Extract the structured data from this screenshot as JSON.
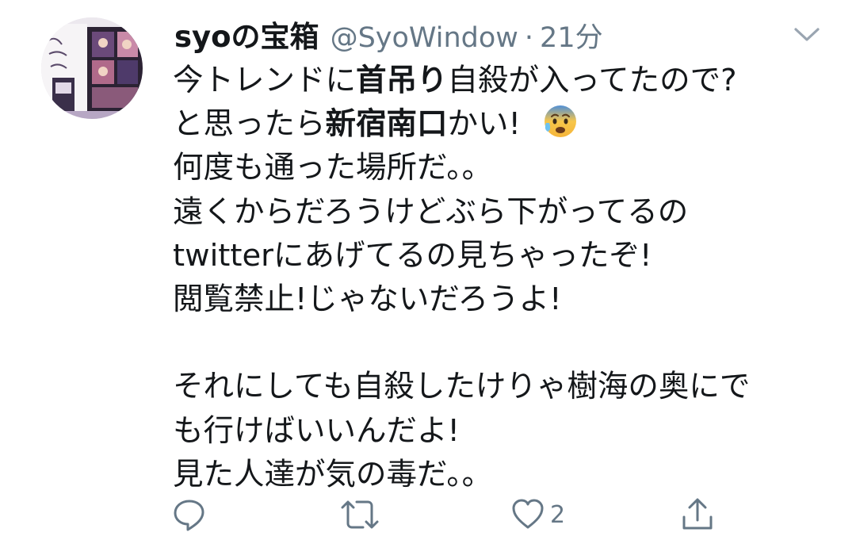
{
  "tweet": {
    "author": {
      "display_name": "syoの宝箱",
      "handle": "@SyoWindow",
      "separator": "·",
      "time": "21分"
    },
    "body": {
      "l1_a": "今トレンドに",
      "l1_b": "首吊り",
      "l1_c": "自殺が入ってたので?",
      "l2_a": "と思ったら",
      "l2_b": "新宿南口",
      "l2_c": "かい!",
      "l3": "何度も通った場所だ。。",
      "l4": "遠くからだろうけどぶら下がってるの",
      "l5": "twitterにあげてるの見ちゃったぞ!",
      "l6": "閲覧禁止!じゃないだろうよ!",
      "l7": "それにしても自殺したけりゃ樹海の奥にで",
      "l8": "も行けばいいんだよ!",
      "l9": "見た人達が気の毒だ。。"
    },
    "actions": {
      "like_count": "2"
    },
    "icons": {
      "reply": "reply-icon",
      "retweet": "retweet-icon",
      "like": "heart-icon",
      "share": "share-icon",
      "caret": "chevron-down-icon",
      "emoji": "anxious-face-with-sweat-emoji"
    },
    "colors": {
      "text": "#14171a",
      "secondary": "#657786"
    }
  }
}
